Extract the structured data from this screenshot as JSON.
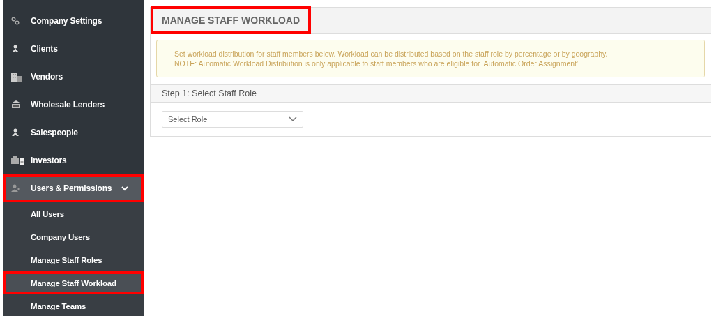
{
  "sidebar": {
    "items": [
      {
        "label": "Company Settings",
        "selected": false,
        "highlighted": false
      },
      {
        "label": "Clients",
        "selected": false,
        "highlighted": false
      },
      {
        "label": "Vendors",
        "selected": false,
        "highlighted": false
      },
      {
        "label": "Wholesale Lenders",
        "selected": false,
        "highlighted": false
      },
      {
        "label": "Salespeople",
        "selected": false,
        "highlighted": false
      },
      {
        "label": "Investors",
        "selected": false,
        "highlighted": false
      },
      {
        "label": "Users & Permissions",
        "selected": true,
        "highlighted": true,
        "expanded": true,
        "children": [
          {
            "label": "All Users",
            "selected": false,
            "highlighted": false
          },
          {
            "label": "Company Users",
            "selected": false,
            "highlighted": false
          },
          {
            "label": "Manage Staff Roles",
            "selected": false,
            "highlighted": false
          },
          {
            "label": "Manage Staff Workload",
            "selected": true,
            "highlighted": true
          },
          {
            "label": "Manage Teams",
            "selected": false,
            "highlighted": false
          }
        ]
      }
    ]
  },
  "page": {
    "title": "MANAGE STAFF WORKLOAD",
    "title_highlighted": true,
    "notice": [
      "Set workload distribution for staff members below. Workload can be distributed based on the staff role by percentage or by geography.",
      "NOTE: Automatic Workload Distribution is only applicable to staff members who are eligible for 'Automatic Order Assignment'"
    ],
    "step": "Step 1: Select Staff Role",
    "role_select": {
      "placeholder": "Select Role"
    }
  }
}
